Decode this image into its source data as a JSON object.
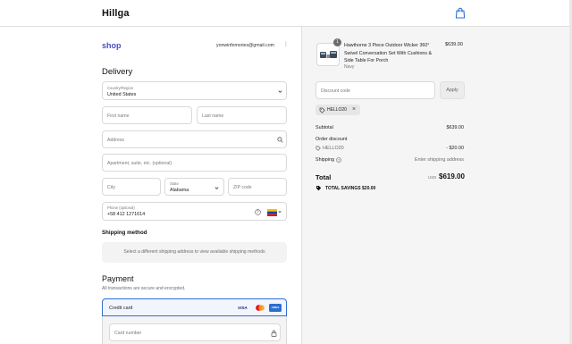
{
  "header": {
    "brand": "Hillga",
    "cart_icon": "shopping-bag-icon"
  },
  "account": {
    "shop_label": "shop",
    "email": "yonwinfemories@gmail.com"
  },
  "delivery": {
    "heading": "Delivery",
    "country": {
      "label": "Country/Region",
      "value": "United States"
    },
    "first_name": {
      "placeholder": "First name"
    },
    "last_name": {
      "placeholder": "Last name"
    },
    "address": {
      "placeholder": "Address"
    },
    "apartment": {
      "placeholder": "Apartment, suite, etc. (optional)"
    },
    "city": {
      "placeholder": "City"
    },
    "state": {
      "label": "State",
      "value": "Alabama"
    },
    "zip": {
      "placeholder": "ZIP code"
    },
    "phone": {
      "label": "Phone (optional)",
      "value": "+58 412 1271614"
    }
  },
  "shipping": {
    "heading": "Shipping method",
    "message": "Select a different shipping address to view available shipping methods"
  },
  "payment": {
    "heading": "Payment",
    "subtitle": "All transactions are secure and encrypted.",
    "method_label": "Credit card",
    "card_brands": [
      "VISA",
      "mastercard",
      "AMEX"
    ],
    "card_number": {
      "placeholder": "Card number"
    }
  },
  "summary": {
    "item": {
      "quantity": "1",
      "name": "Hawthorne 3 Piece Outdoor Wicker 360° Swivel Conversation Set With Cushions & Side Table For Porch",
      "variant": "Navy",
      "price": "$639.00"
    },
    "discount": {
      "placeholder": "Discount code",
      "apply_label": "Apply",
      "applied_code": "HELLO20"
    },
    "subtotal_label": "Subtotal",
    "subtotal_value": "$639.00",
    "order_discount_label": "Order discount",
    "order_discount_code": "HELLO20",
    "order_discount_value": "- $20.00",
    "shipping_label": "Shipping",
    "shipping_value": "Enter shipping address",
    "total_label": "Total",
    "currency": "USD",
    "total_value": "$619.00",
    "savings_label": "TOTAL SAVINGS",
    "savings_value": "$20.00"
  },
  "colors": {
    "accent": "#2f6fd6",
    "shop_purple": "#4a4fc8",
    "panel_bg": "#f5f5f5"
  }
}
